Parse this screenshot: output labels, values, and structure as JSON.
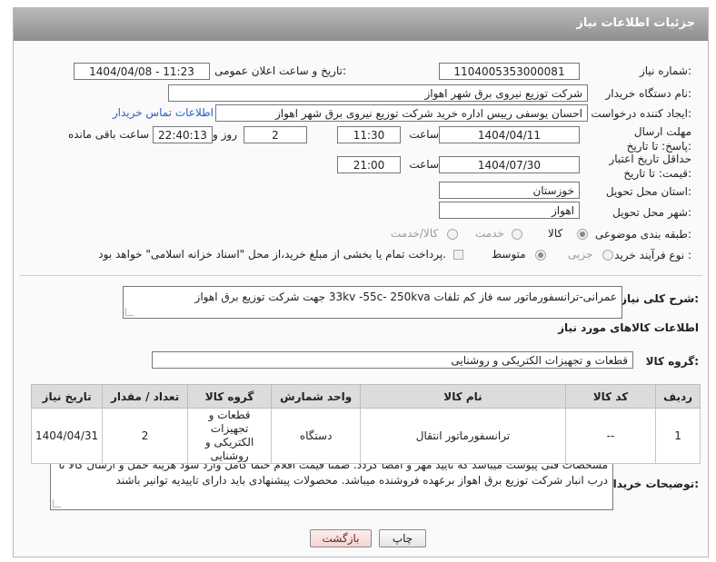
{
  "header": {
    "title": "جزئیات اطلاعات نیاز"
  },
  "fields": {
    "need_number": {
      "label": "شماره نیاز:",
      "value": "1104005353000081"
    },
    "announce": {
      "label": "تاریخ و ساعت اعلان عمومی:",
      "value": "1404/04/08 - 11:23"
    },
    "buyer_org": {
      "label": "نام دستگاه خریدار:",
      "value": "شرکت توزیع نیروی برق شهر اهواز"
    },
    "requester": {
      "label": "ایجاد کننده درخواست:",
      "value": "احسان یوسفی رییس اداره خرید شرکت توزیع نیروی برق شهر اهواز",
      "contact_link": "اطلاعات تماس خریدار"
    },
    "deadline": {
      "label": "مهلت ارسال پاسخ: تا تاریخ:",
      "date": "1404/04/11",
      "time_label": "ساعت",
      "time": "11:30",
      "days": "2",
      "days_label": "روز و",
      "remaining": "22:40:13",
      "remaining_label": "ساعت باقی مانده"
    },
    "validity": {
      "label": "حداقل تاریخ اعتبار قیمت: تا تاریخ:",
      "date": "1404/07/30",
      "time_label": "ساعت",
      "time": "21:00"
    },
    "province": {
      "label": "استان محل تحویل:",
      "value": "خوزستان"
    },
    "city": {
      "label": "شهر محل تحویل:",
      "value": "اهواز"
    },
    "category": {
      "label": "طبقه بندی موضوعی:",
      "options": [
        "کالا",
        "خدمت",
        "کالا/خدمت"
      ],
      "selected": "کالا"
    },
    "process": {
      "label": "نوع فرآیند خرید :",
      "options": [
        "جزیی",
        "متوسط"
      ],
      "selected": "متوسط",
      "note": "پرداخت تمام یا بخشی از مبلغ خرید،از محل \"اسناد خزانه اسلامی\" خواهد بود."
    }
  },
  "description": {
    "label": "شرح کلی نیاز:",
    "value": "عمرانی-ترانسفورماتور سه فاز کم تلفات 33kv -55c- 250kva جهت شرکت توزیع برق اهواز"
  },
  "goods_section": {
    "title": "اطلاعات کالاهای مورد نیاز",
    "group_label": "گروه کالا:",
    "group_value": "قطعات و تجهیزات الکتریکی و روشنایی",
    "table": {
      "headers": [
        "ردیف",
        "کد کالا",
        "نام کالا",
        "واحد شمارش",
        "گروه کالا",
        "تعداد / مقدار",
        "تاریخ نیاز"
      ],
      "rows": [
        [
          "1",
          "--",
          "ترانسفورماتور انتقال",
          "دستگاه",
          "قطعات و تجهیزات الکتریکی و روشنایی",
          "2",
          "1404/04/31"
        ]
      ]
    }
  },
  "buyer_notes": {
    "label": "توضیحات خریدار:",
    "value": "مشخصات فنی پیوست میباشد که تایید مهر و امضا گردد. ضمنا قیمت اقلام حتما کامل وارد شود هزینه حمل و ارسال کالا تا درب انبار شرکت توزیع برق اهواز برعهده فروشنده میباشد. محصولات پیشنهادی باید دارای تاییدیه توانیر باشند"
  },
  "buttons": {
    "print": "چاپ",
    "back": "بازگشت"
  },
  "watermark": {
    "text": "AriaTender.net"
  },
  "colors": {
    "header": "#9a9a9a",
    "link": "#2a62c6",
    "back_button": "#f5d3d3",
    "watermark": "#e9c9c9"
  }
}
